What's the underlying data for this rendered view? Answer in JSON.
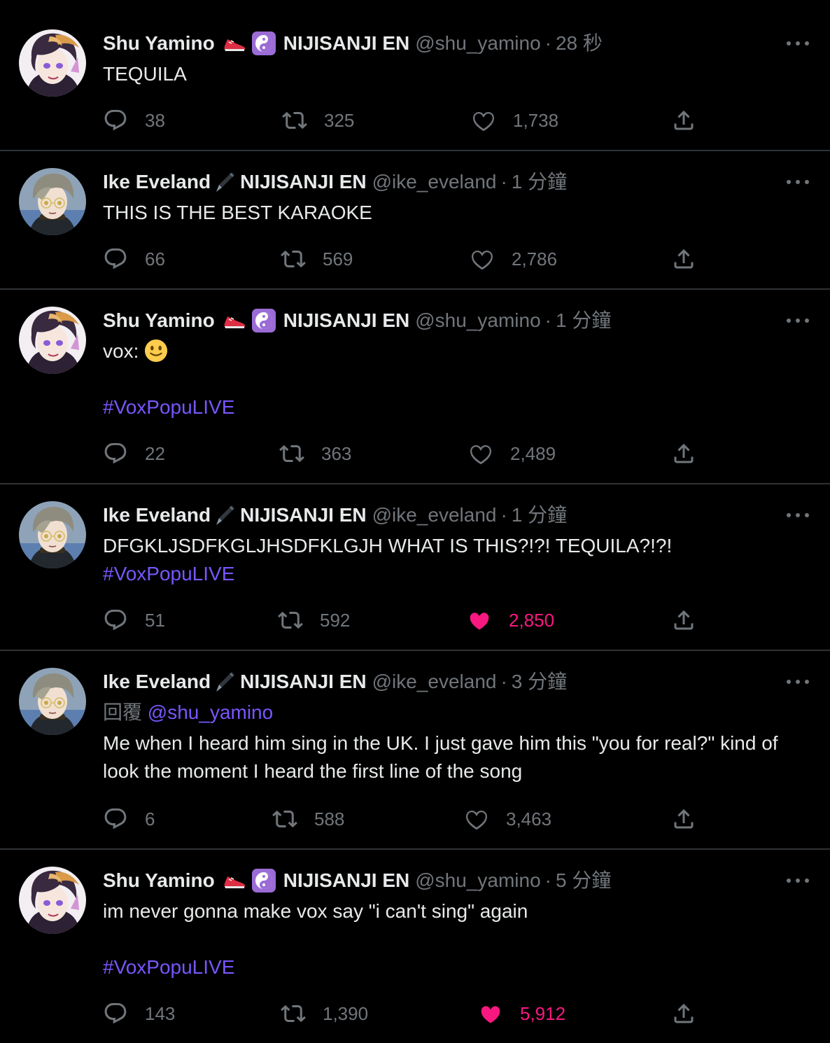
{
  "feed": {
    "tweets": [
      {
        "author": "Shu Yamino",
        "badge_1": "sneaker-emoji",
        "badge_2": "yin-yang-emoji",
        "org": "NIJISANJI EN",
        "handle": "@shu_yamino",
        "separator": "·",
        "time": "28 秒",
        "text": "TEQUILA",
        "replies": "38",
        "retweets": "325",
        "likes": "1,738",
        "liked": false
      },
      {
        "author": "Ike Eveland",
        "badge_1": "fountain-pen-emoji",
        "org": "NIJISANJI EN",
        "handle": "@ike_eveland",
        "separator": "·",
        "time": "1 分鐘",
        "text": "THIS IS THE BEST KARAOKE",
        "replies": "66",
        "retweets": "569",
        "likes": "2,786",
        "liked": false
      },
      {
        "author": "Shu Yamino",
        "badge_1": "sneaker-emoji",
        "badge_2": "yin-yang-emoji",
        "org": "NIJISANJI EN",
        "handle": "@shu_yamino",
        "separator": "·",
        "time": "1 分鐘",
        "text": "vox:",
        "emoji": "slightly-smiling-face-emoji",
        "hashtag": "#VoxPopuLIVE",
        "replies": "22",
        "retweets": "363",
        "likes": "2,489",
        "liked": false
      },
      {
        "author": "Ike Eveland",
        "badge_1": "fountain-pen-emoji",
        "org": "NIJISANJI EN",
        "handle": "@ike_eveland",
        "separator": "·",
        "time": "1 分鐘",
        "text": "DFGKLJSDFKGLJHSDFKLGJH WHAT IS THIS?!?! TEQUILA?!?!",
        "hashtag": "#VoxPopuLIVE",
        "replies": "51",
        "retweets": "592",
        "likes": "2,850",
        "liked": true
      },
      {
        "author": "Ike Eveland",
        "badge_1": "fountain-pen-emoji",
        "org": "NIJISANJI EN",
        "handle": "@ike_eveland",
        "separator": "·",
        "time": "3 分鐘",
        "reply_label": "回覆",
        "reply_to": "@shu_yamino",
        "text": "Me when I heard him sing in the UK. I just gave him this \"you for real?\" kind of look the moment I heard the first line of the song",
        "replies": "6",
        "retweets": "588",
        "likes": "3,463",
        "liked": false
      },
      {
        "author": "Shu Yamino",
        "badge_1": "sneaker-emoji",
        "badge_2": "yin-yang-emoji",
        "org": "NIJISANJI EN",
        "handle": "@shu_yamino",
        "separator": "·",
        "time": "5 分鐘",
        "text": "im never gonna make vox say \"i can't sing\" again",
        "hashtag": "#VoxPopuLIVE",
        "replies": "143",
        "retweets": "1,390",
        "likes": "5,912",
        "liked": true
      }
    ]
  },
  "colors": {
    "background": "#000000",
    "text": "#e7e9ea",
    "muted": "#71767b",
    "divider": "#2f3336",
    "link": "#7856ff",
    "like": "#f91880"
  },
  "icons": {
    "reply": "reply-bubble-icon",
    "retweet": "retweet-icon",
    "like": "heart-icon",
    "share": "share-icon",
    "more": "more-dots-icon"
  }
}
